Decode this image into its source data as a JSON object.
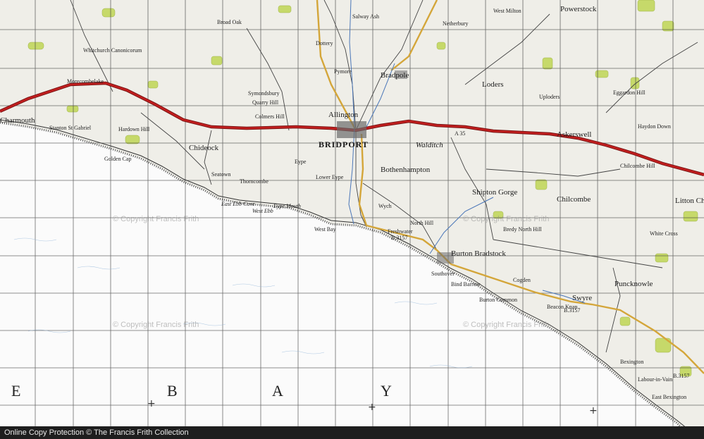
{
  "map": {
    "sea_letters": [
      "E",
      "B",
      "A",
      "Y"
    ],
    "watermarks": [
      "© Copyright Francis Frith",
      "© Copyright Francis Frith",
      "© Copyright Francis Frith",
      "© Copyright Francis Frith"
    ],
    "places": {
      "bridport": "BRIDPORT",
      "allington": "Allington",
      "bradpole": "Bradpole",
      "walditch": "Walditch",
      "bothenhampton": "Bothenhampton",
      "west_bay": "West Bay",
      "wych": "Wych",
      "symondsbury": "Symondsbury",
      "chideock": "Chideock",
      "seatown": "Seatown",
      "eype": "Eype",
      "lower_eype": "Lower Eype",
      "eype_mouth": "Eype Mouth",
      "east_ebb_cove": "East Ebb Cove",
      "west_ebb": "West Ebb",
      "thorncombe_beacon": "Thorncombe",
      "charmouth": "Charmouth",
      "morecombelake": "Morecombelake",
      "whitchurch_canonicorum": "Whitchurch Canonicorum",
      "shipton_gorge": "Shipton Gorge",
      "burton_bradstock": "Burton Bradstock",
      "swyre": "Swyre",
      "puncknowle": "Puncknowle",
      "askerswell": "Askerswell",
      "chilcombe": "Chilcombe",
      "uploders": "Uploders",
      "powerstock": "Powerstock",
      "litton_cheney": "Litton Chene",
      "loders": "Loders",
      "pymore": "Pymore",
      "dottery": "Dottery",
      "bredy": "Bredy North Hill",
      "north_hill": "North Hill",
      "burton_common": "Burton Common",
      "bexington": "Bexington",
      "west_milton": "West Milton",
      "netherbury": "Netherbury",
      "salway_ash": "Salway Ash",
      "broadoak": "Broad Oak",
      "quarry_hill": "Quarry Hill",
      "golden_cap": "Golden Cap",
      "stanton_st_gabriel": "Stanton St Gabriel",
      "hardown_hill": "Hardown Hill",
      "colmers_hill": "Colmers Hill",
      "haydon_down": "Haydon Down",
      "eggardon": "Eggardon Hill",
      "chilcombe_hill": "Chilcombe Hill",
      "white_cross": "White Cross",
      "cogden": "Cogden",
      "southover": "Southover",
      "bind_barrow": "Bind Barrow",
      "freshwater": "Freshwater",
      "beacon_knap": "Beacon Knap",
      "east_bexington": "East Bexington",
      "labour_in_vain": "Labour-in-Vain"
    },
    "roads": {
      "a35": "A 35",
      "b3157": "B.3157",
      "b3157b": "B.3157",
      "b3157c": "B.3157"
    },
    "colors": {
      "paper": "#f4f3ef",
      "sea": "#fbfbfb",
      "grid": "#3a3a3a",
      "road_main": "#c21e1e",
      "road_b": "#d4a63a",
      "woods": "#c6d96a",
      "river": "#4a76b8"
    }
  },
  "footer": {
    "text": "Online Copy Protection  © The Francis Frith Collection"
  }
}
